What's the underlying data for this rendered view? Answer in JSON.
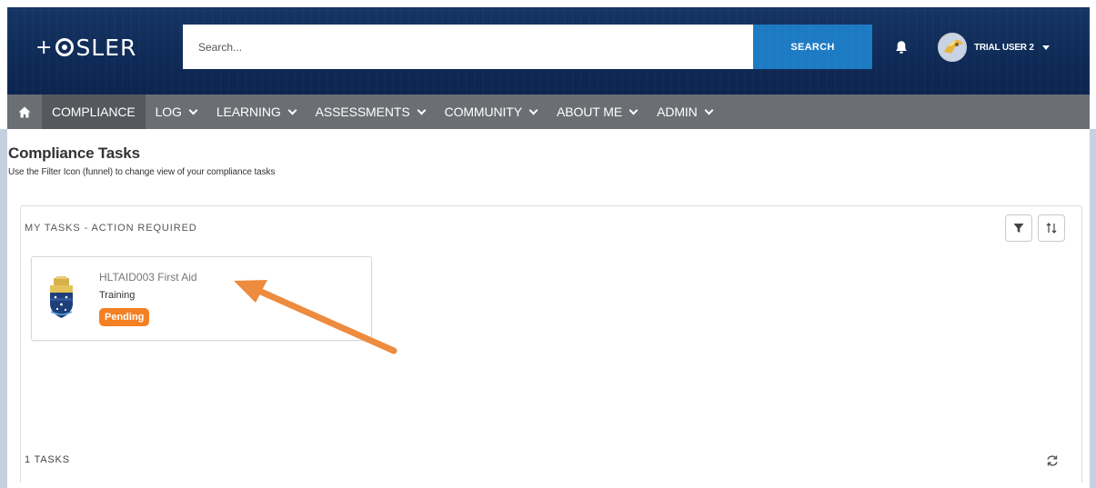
{
  "header": {
    "logo_text": "+OSLER",
    "logo_prefix": "+",
    "logo_rest": "SLER",
    "search": {
      "placeholder": "Search...",
      "button_label": "SEARCH"
    },
    "user": {
      "name": "TRIAL USER 2"
    }
  },
  "nav": {
    "items": [
      {
        "label": "",
        "icon": "home-icon"
      },
      {
        "label": "COMPLIANCE",
        "active": true
      },
      {
        "label": "LOG"
      },
      {
        "label": "LEARNING"
      },
      {
        "label": "ASSESSMENTS"
      },
      {
        "label": "COMMUNITY"
      },
      {
        "label": "ABOUT ME"
      },
      {
        "label": "ADMIN"
      }
    ]
  },
  "page": {
    "title": "Compliance Tasks",
    "subtitle": "Use the Filter Icon (funnel) to change view of your compliance tasks"
  },
  "tasks_panel": {
    "title": "MY TASKS - ACTION REQUIRED",
    "tasks": [
      {
        "name": "HLTAID003 First Aid",
        "type": "Training",
        "status": "Pending",
        "icon": "crest-icon"
      }
    ],
    "count_text": "1 TASKS"
  },
  "colors": {
    "header_bg": "#0f2b57",
    "nav_bg": "#6b6f73",
    "nav_active_bg": "#55595d",
    "search_button": "#1d7bc4",
    "status_pending": "#f48024",
    "annotation_arrow": "#ed8b3e"
  }
}
